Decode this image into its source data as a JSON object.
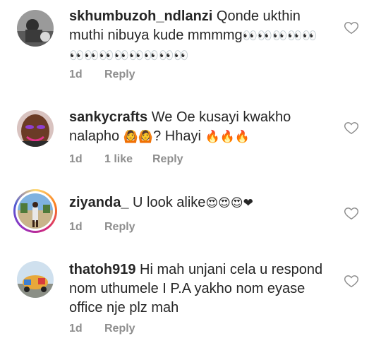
{
  "comments": [
    {
      "username": "skhumbuzoh_ndlanzi",
      "text": "Qonde ukthin muthi nibuya kude mmmmg",
      "emojis": "👀👀👀👀👀👀👀👀👀👀👀👀👀",
      "time": "1d",
      "likes": "",
      "reply": "Reply"
    },
    {
      "username": "sankycrafts",
      "text": "We Oe kusayi kwakho nalapho",
      "emojis_a": "🙆🙆",
      "text_b": "? Hhayi",
      "emojis_b": "🔥🔥🔥",
      "time": "1d",
      "likes": "1 like",
      "reply": "Reply"
    },
    {
      "username": "ziyanda_",
      "text": "U look alike",
      "emojis": "😍😍😍❤",
      "time": "1d",
      "likes": "",
      "reply": "Reply"
    },
    {
      "username": "thatoh919",
      "text": "Hi mah unjani cela u respond nom uthumele I P.A yakho nom eyase office nje plz mah",
      "time": "1d",
      "likes": "",
      "reply": "Reply"
    }
  ],
  "icons": {
    "like": "heart-outline-icon"
  }
}
